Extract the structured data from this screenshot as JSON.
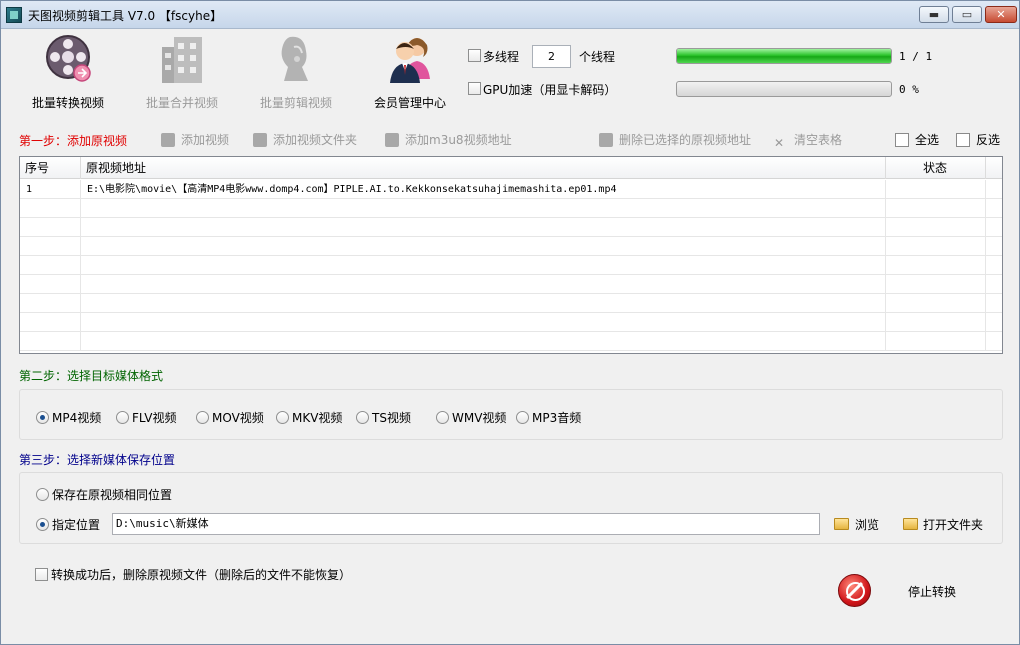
{
  "window": {
    "title": "天图视频剪辑工具 V7.0  【fscyhe】",
    "buttons": {
      "minimize": "▬",
      "maximize": "▭",
      "close": "✕"
    }
  },
  "toolbar": {
    "batch_convert": "批量转换视频",
    "batch_merge": "批量合并视频",
    "batch_edit": "批量剪辑视频",
    "member_center": "会员管理中心"
  },
  "options": {
    "multithread_label": "多线程",
    "thread_count": "2",
    "thread_unit": "个线程",
    "gpu_label": "GPU加速（用显卡解码）",
    "progress1_text": "1 / 1",
    "progress1_fraction": 1.0,
    "progress2_text": "0 %",
    "progress2_fraction": 0.0
  },
  "step1": {
    "label": "第一步：添加原视频",
    "actions": {
      "add_video": "添加视频",
      "add_folder": "添加视频文件夹",
      "add_m3u8": "添加m3u8视频地址",
      "delete_selected": "删除已选择的原视频地址",
      "clear_table": "清空表格",
      "select_all": "全选",
      "invert": "反选"
    },
    "table": {
      "columns": {
        "index": "序号",
        "source": "原视频地址",
        "status": "状态"
      },
      "rows": [
        {
          "index": "1",
          "source": "E:\\电影院\\movie\\【高清MP4电影www.domp4.com】PIPLE.AI.to.Kekkonsekatsuhajimemashita.ep01.mp4",
          "status": ""
        }
      ]
    }
  },
  "step2": {
    "label": "第二步：选择目标媒体格式",
    "formats": [
      "MP4视频",
      "FLV视频",
      "MOV视频",
      "MKV视频",
      "TS视频",
      "WMV视频",
      "MP3音频"
    ],
    "selected": "MP4视频"
  },
  "step3": {
    "label": "第三步：选择新媒体保存位置",
    "same_location": "保存在原视频相同位置",
    "custom_location": "指定位置",
    "path_value": "D:\\music\\新媒体",
    "browse": "浏览",
    "open_folder": "打开文件夹"
  },
  "footer": {
    "delete_after": "转换成功后，删除原视频文件（删除后的文件不能恢复）",
    "stop": "停止转换"
  },
  "colors": {
    "step1": "#e00000",
    "step2": "#006400",
    "step3": "#00008b"
  }
}
